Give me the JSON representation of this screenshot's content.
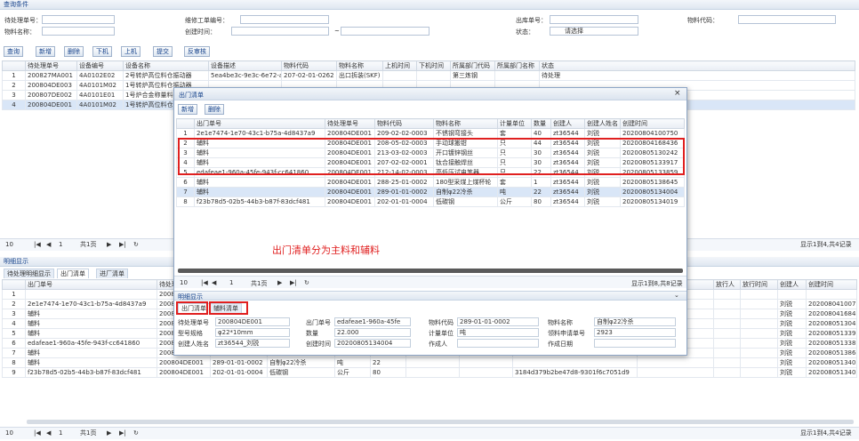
{
  "query_panel": {
    "title": "查询条件",
    "labels": {
      "pending_no": "待处理单号：",
      "code": "物料名称：",
      "maint_no": "维修工单编号：",
      "created_time": "创建时间：",
      "range_sep": "~",
      "out_no": "出库单号：",
      "status": "状态：",
      "material_code": "物料代码："
    },
    "status_value": "请选择"
  },
  "toolbar": {
    "query": "查询",
    "add": "新增",
    "delete": "删除",
    "down": "下机",
    "up": "上机",
    "clear": "提交",
    "export": "反审核"
  },
  "main_grid": {
    "headers": [
      "",
      "待处理单号",
      "设备编号",
      "设备名称",
      "设备描述",
      "物料代码",
      "物料名称",
      "上机时间",
      "下机时间",
      "所属部门代码",
      "所属部门名称",
      "状态"
    ],
    "rows": [
      [
        "1",
        "200827MA001",
        "4A0102E02",
        "2号转炉高位料仓振动器",
        "5ea4be3c-9e3c-6e72-a",
        "207-02-01-0262",
        "出口拆装(SKF)",
        "",
        "",
        "第三炼钢",
        "",
        "待处理"
      ],
      [
        "2",
        "200804DE003",
        "4A0101M02",
        "1号转炉高位料仓振动器",
        "",
        "",
        "",
        "",
        "",
        "",
        "",
        ""
      ],
      [
        "3",
        "200807DE002",
        "4A0101E01",
        "1号炉合金称量料仓",
        "",
        "",
        "",
        "",
        "",
        "",
        "",
        ""
      ],
      [
        "4",
        "200804DE001",
        "4A0101M02",
        "1号转炉高位料仓",
        "",
        "",
        "",
        "",
        "",
        "",
        "",
        ""
      ]
    ],
    "right_pager": "显示1到4,共4记录"
  },
  "pager": {
    "size": "10",
    "page": "1",
    "of": "共1页"
  },
  "detail_panel": {
    "title": "明细显示",
    "tabs": [
      "待处理明细显示",
      "出门清单",
      "进厂清单"
    ],
    "headers": [
      "",
      "出门单号",
      "待处理单号",
      "物料代码",
      "物料名称",
      "计量单位",
      "数量",
      "",
      "",
      "",
      "",
      "放行人",
      "放行时间",
      "创建人",
      "创建时间"
    ],
    "rows": [
      [
        "1",
        "",
        "200804DE001",
        "",
        "",
        "",
        "",
        "",
        "",
        "",
        "",
        "",
        "",
        "",
        ""
      ],
      [
        "2",
        "2e1e7474-1e70-43c1-b75a-4d8437a9",
        "200804DE001",
        "",
        "",
        "",
        "",
        "",
        "",
        "",
        "",
        "",
        "",
        "刘锐",
        "20200804100750"
      ],
      [
        "3",
        "辅料",
        "200804DE001",
        "",
        "",
        "",
        "",
        "",
        "",
        "",
        "",
        "",
        "",
        "刘锐",
        "2020080416843"
      ],
      [
        "4",
        "辅料",
        "200804DE001",
        "",
        "",
        "",
        "",
        "",
        "",
        "",
        "",
        "",
        "",
        "刘锐",
        "2020080513042"
      ],
      [
        "5",
        "辅料",
        "200804DE001",
        "",
        "",
        "",
        "",
        "",
        "",
        "",
        "",
        "",
        "",
        "刘锐",
        "2020080513391"
      ],
      [
        "6",
        "edafeae1-960a-45fe-943f-cc641860",
        "200804DE001",
        "",
        "",
        "",
        "",
        "",
        "",
        "",
        "",
        "",
        "",
        "刘锐",
        "2020080513385"
      ],
      [
        "7",
        "辅料",
        "200804DE001",
        "288-25-01-0002",
        "180型采煤上煤杯轮",
        "盘",
        "1",
        "",
        "",
        "",
        "",
        "",
        "",
        "刘锐",
        "2020080513864"
      ],
      [
        "8",
        "辅料",
        "200804DE001",
        "289-01-01-0002",
        "自制φ22冷杀",
        "吨",
        "22",
        "",
        "",
        "",
        "",
        "",
        "",
        "刘锐",
        "2020080513400"
      ],
      [
        "9",
        "f23b78d5-02b5-44b3-b87f-83dcf481",
        "200804DE001",
        "202-01-01-0004",
        "低碳钢",
        "公斤",
        "80",
        "",
        "",
        "3184d379b2be47d8-9301f6c7051d9",
        "",
        "",
        "",
        "刘锐",
        "2020080513400"
      ]
    ],
    "extra_cell": "56b3c4",
    "right_pager": "显示1到4,共4记录"
  },
  "modal": {
    "title": "出门清单",
    "toolbar": {
      "add": "新增",
      "delete": "删除"
    },
    "headers": [
      "",
      "出门单号",
      "待处理单号",
      "物料代码",
      "物料名称",
      "计量单位",
      "数量",
      "创建人",
      "创建人姓名",
      "创建时间"
    ],
    "rows": [
      [
        "1",
        "2e1e7474-1e70-43c1-b75a-4d8437a9",
        "200804DE001",
        "209-02-02-0003",
        "不锈钢弯接头",
        "套",
        "40",
        "zt36544",
        "刘锐",
        "20200804100750"
      ],
      [
        "2",
        "辅料",
        "200804DE001",
        "208-05-02-0003",
        "手动球搬钳",
        "只",
        "44",
        "zt36544",
        "刘锐",
        "20200804168436"
      ],
      [
        "3",
        "辅料",
        "200804DE001",
        "213-03-02-0003",
        "开口镀锌钢丝",
        "只",
        "30",
        "zt36544",
        "刘锐",
        "20200805130242"
      ],
      [
        "4",
        "辅料",
        "200804DE001",
        "207-02-02-0001",
        "钛合接触焊丝",
        "只",
        "30",
        "zt36544",
        "刘锐",
        "20200805133917"
      ],
      [
        "5",
        "edafeae1-960a-45fe-943f-cc641860",
        "200804DE001",
        "212-14-02-0003",
        "高低压试电笔器",
        "只",
        "22",
        "zt36544",
        "刘锐",
        "20200805133859"
      ],
      [
        "6",
        "辅料",
        "200804DE001",
        "288-25-01-0002",
        "180型采煤上煤杯轮",
        "套",
        "1",
        "zt36544",
        "刘锐",
        "20200805138645"
      ],
      [
        "7",
        "辅料",
        "200804DE001",
        "289-01-01-0002",
        "自制φ22冷杀",
        "吨",
        "22",
        "zt36544",
        "刘锐",
        "20200805134004"
      ],
      [
        "8",
        "f23b78d5-02b5-44b3-b87f-83dcf481",
        "200804DE001",
        "202-01-01-0004",
        "低碳钢",
        "公斤",
        "80",
        "zt36544",
        "刘锐",
        "20200805134019"
      ]
    ],
    "pager": {
      "size": "10",
      "page": "1",
      "of": "共1页",
      "info": "显示1到8,共8记录"
    },
    "annotation": "出门清单分为主料和辅料",
    "detail": {
      "title": "明细显示",
      "tabs": [
        "出门清单",
        "辅料清单"
      ],
      "fields": [
        {
          "label": "待处理单号",
          "value": "200804DE001"
        },
        {
          "label": "出门单号",
          "value": "edafeae1-960a-45fe"
        },
        {
          "label": "物料代码",
          "value": "289-01-01-0002"
        },
        {
          "label": "物料名称",
          "value": "自制φ22冷杀"
        },
        {
          "label": "型号规格",
          "value": "φ22*10mm"
        },
        {
          "label": "数量",
          "value": "22.000"
        },
        {
          "label": "计量单位",
          "value": "吨"
        },
        {
          "label": "领料申请单号",
          "value": "2923"
        },
        {
          "label": "创建人姓名",
          "value": "zt36544_刘锐"
        },
        {
          "label": "创建时间",
          "value": "20200805134004"
        },
        {
          "label": "作成人",
          "value": ""
        },
        {
          "label": "作成日期",
          "value": ""
        }
      ]
    }
  },
  "colors": {
    "accent": "#15428b",
    "highlight": "#e02020",
    "selected": "#d9e6f7"
  }
}
